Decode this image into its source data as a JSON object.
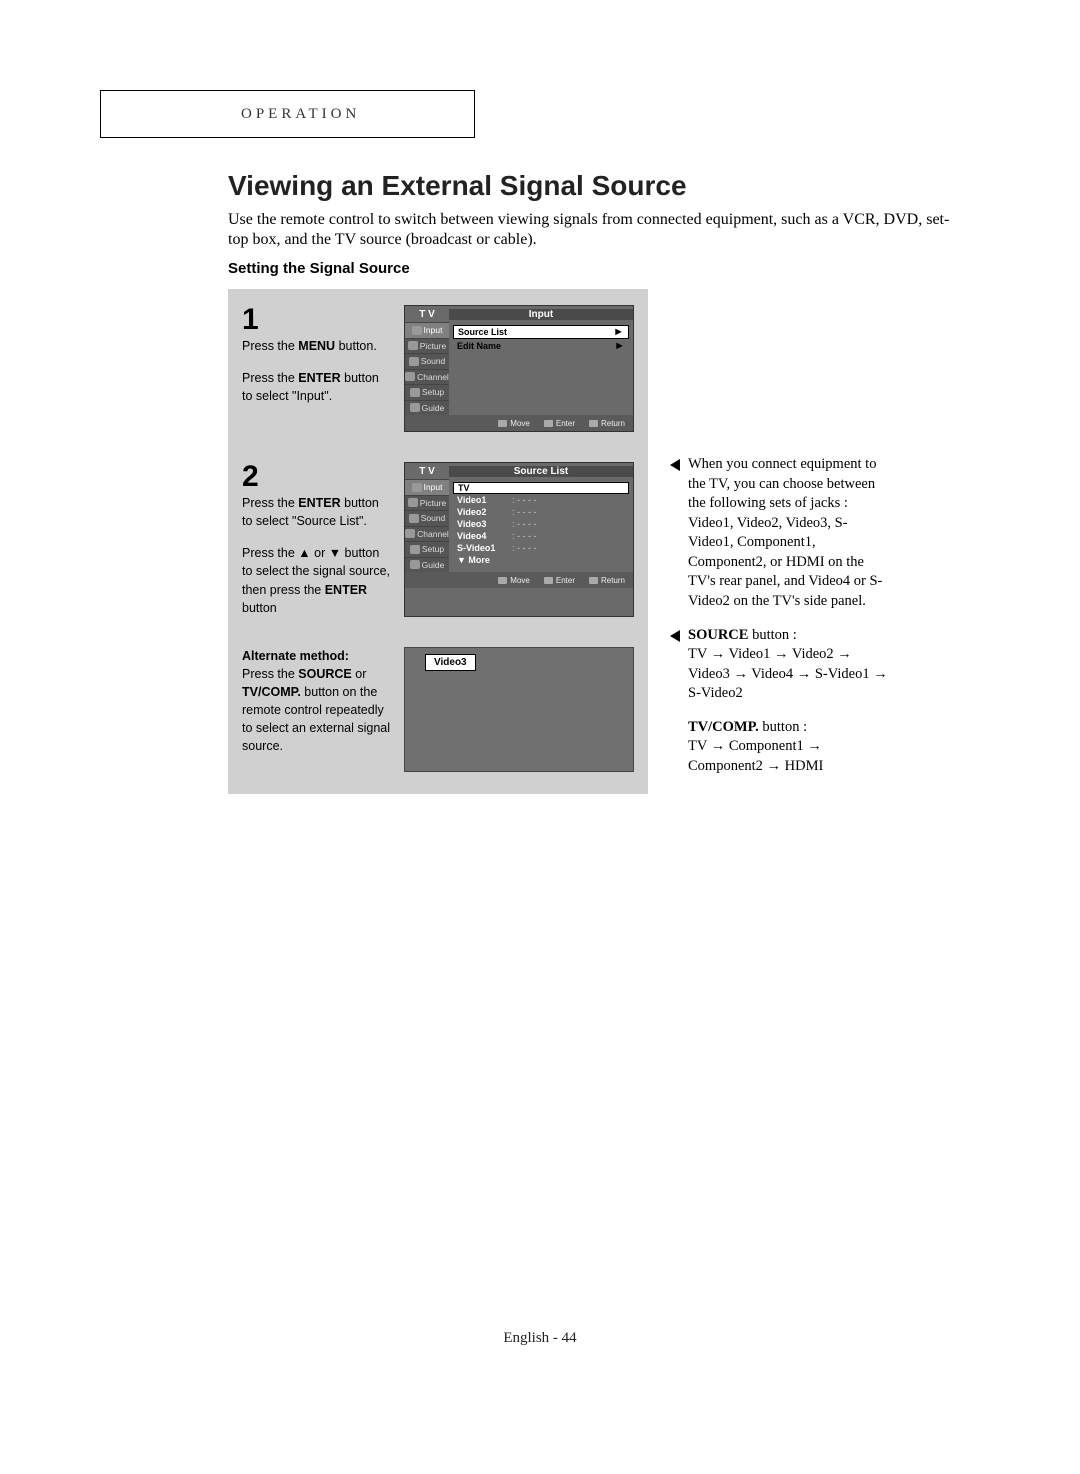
{
  "section_label": "OPERATION",
  "title": "Viewing an External Signal Source",
  "intro": "Use the remote control to switch between viewing signals from connected equipment, such as a VCR, DVD, set-top box, and the TV source (broadcast or cable).",
  "subheading": "Setting the Signal Source",
  "step1": {
    "num": "1",
    "line1a": "Press the ",
    "line1b": "MENU",
    "line1c": " button.",
    "line2a": "Press the ",
    "line2b": "ENTER",
    "line2c": " button to select \"Input\"."
  },
  "step2": {
    "num": "2",
    "line1a": "Press the ",
    "line1b": "ENTER",
    "line1c": " button to select \"Source List\".",
    "line2a": "Press the ▲ or ▼ button to select the signal source, then press the ",
    "line2b": "ENTER",
    "line2c": " button"
  },
  "alt": {
    "heading": "Alternate method:",
    "text1": "Press the ",
    "b1": "SOURCE",
    "text2": " or ",
    "b2": "TV/COMP.",
    "text3": " button on the remote control repeatedly to select an external signal source."
  },
  "osd1": {
    "header_left": "T V",
    "header_right": "Input",
    "tabs": [
      "Input",
      "Picture",
      "Sound",
      "Channel",
      "Setup",
      "Guide"
    ],
    "items": [
      {
        "label": "Source List",
        "arrow": "►"
      },
      {
        "label": "Edit Name",
        "arrow": "►"
      }
    ],
    "footer": [
      "Move",
      "Enter",
      "Return"
    ]
  },
  "osd2": {
    "header_left": "T V",
    "header_right": "Source List",
    "tabs": [
      "Input",
      "Picture",
      "Sound",
      "Channel",
      "Setup",
      "Guide"
    ],
    "rows": [
      {
        "label": "TV",
        "val": ""
      },
      {
        "label": "Video1",
        "val": ": - - - -"
      },
      {
        "label": "Video2",
        "val": ": - - - -"
      },
      {
        "label": "Video3",
        "val": ": - - - -"
      },
      {
        "label": "Video4",
        "val": ": - - - -"
      },
      {
        "label": "S-Video1",
        "val": ": - - - -"
      },
      {
        "label": "▼ More",
        "val": ""
      }
    ],
    "footer": [
      "Move",
      "Enter",
      "Return"
    ]
  },
  "osd3": {
    "badge": "Video3"
  },
  "note1": "When you connect equipment to the TV, you can choose between the following sets of jacks : Video1, Video2, Video3, S-Video1, Component1, Component2, or HDMI on the TV's rear panel, and Video4 or S-Video2 on the TV's side panel.",
  "note2_b1": "SOURCE",
  "note2_rest": " button :",
  "note2_line": "TV → Video1 → Video2 → Video3  → Video4 → S-Video1 → S-Video2",
  "note3_b1": "TV/COMP.",
  "note3_rest": " button :",
  "note3_line": "TV → Component1 → Component2 → HDMI",
  "footer": "English - 44"
}
